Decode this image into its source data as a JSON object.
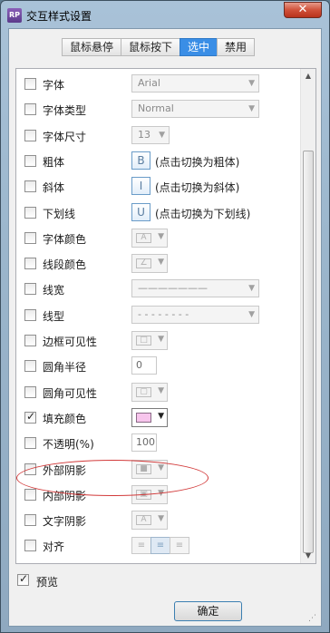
{
  "window": {
    "title": "交互样式设置",
    "app_icon_text": "RP",
    "close_glyph": "✕"
  },
  "tabs": [
    {
      "label": "鼠标悬停",
      "active": false
    },
    {
      "label": "鼠标按下",
      "active": false
    },
    {
      "label": "选中",
      "active": true
    },
    {
      "label": "禁用",
      "active": false
    }
  ],
  "rows": [
    {
      "label": "字体",
      "checked": false,
      "control": "combo",
      "value": "Arial"
    },
    {
      "label": "字体类型",
      "checked": false,
      "control": "combo",
      "value": "Normal"
    },
    {
      "label": "字体尺寸",
      "checked": false,
      "control": "combo-short",
      "value": "13"
    },
    {
      "label": "粗体",
      "checked": false,
      "control": "toggle",
      "glyph": "B",
      "hint": "(点击切换为粗体)"
    },
    {
      "label": "斜体",
      "checked": false,
      "control": "toggle",
      "glyph": "I",
      "hint": "(点击切换为斜体)"
    },
    {
      "label": "下划线",
      "checked": false,
      "control": "toggle",
      "glyph": "U",
      "hint": "(点击切换为下划线)"
    },
    {
      "label": "字体颜色",
      "checked": false,
      "control": "color",
      "glyph": "A"
    },
    {
      "label": "线段颜色",
      "checked": false,
      "control": "color",
      "glyph": "∠"
    },
    {
      "label": "线宽",
      "checked": false,
      "control": "combo",
      "value": "———————"
    },
    {
      "label": "线型",
      "checked": false,
      "control": "combo",
      "value": "- - - - - - - -"
    },
    {
      "label": "边框可见性",
      "checked": false,
      "control": "color",
      "glyph": "□"
    },
    {
      "label": "圆角半径",
      "checked": false,
      "control": "number",
      "value": "0"
    },
    {
      "label": "圆角可见性",
      "checked": false,
      "control": "color",
      "glyph": "▢"
    },
    {
      "label": "填充颜色",
      "checked": true,
      "control": "color-active",
      "glyph": ""
    },
    {
      "label": "不透明(%)",
      "checked": false,
      "control": "number",
      "value": "100"
    },
    {
      "label": "外部阴影",
      "checked": false,
      "control": "color",
      "glyph": "■"
    },
    {
      "label": "内部阴影",
      "checked": false,
      "control": "color",
      "glyph": "▣"
    },
    {
      "label": "文字阴影",
      "checked": false,
      "control": "color",
      "glyph": "A"
    },
    {
      "label": "对齐",
      "checked": false,
      "control": "align",
      "options": [
        "≡",
        "≡",
        "≡"
      ]
    }
  ],
  "preview": {
    "label": "预览",
    "checked": true
  },
  "ok_button": {
    "label": "确定"
  },
  "colors": {
    "accent": "#3a8ee6",
    "fill_color": "#f7c5ec",
    "highlight": "#d23a3a"
  }
}
